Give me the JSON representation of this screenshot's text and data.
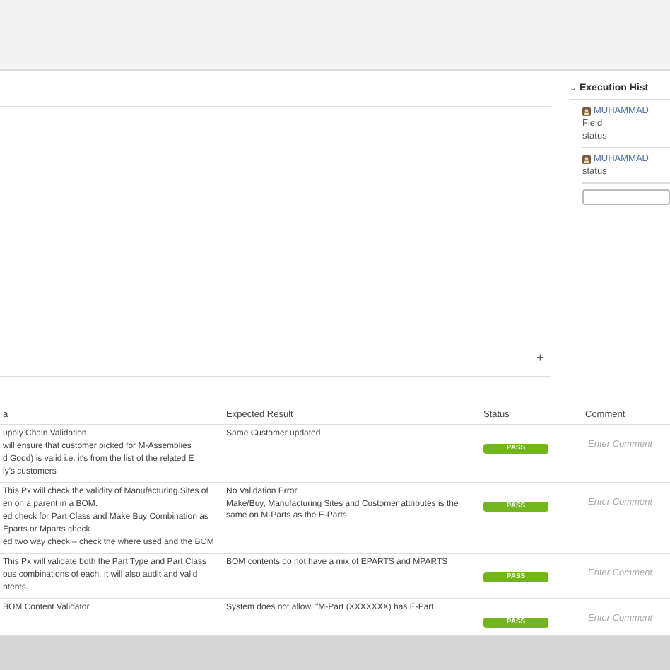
{
  "history": {
    "caret": "⌄",
    "title": "Execution Hist",
    "expanded": true,
    "entries": [
      {
        "user": "MUHAMMAD",
        "lines": [
          "Field",
          "status"
        ]
      },
      {
        "user": "MUHAMMAD",
        "lines": [
          "status"
        ]
      }
    ]
  },
  "add_symbol": "+",
  "table": {
    "columns": [
      "a",
      "Expected Result",
      "Status",
      "Comment"
    ],
    "rows": [
      {
        "description": [
          "upply Chain Validation",
          "will ensure that customer picked for M-Assemblies",
          "d Good) is valid i.e. it's from the list of the related E",
          "ly's customers"
        ],
        "expected": [
          "Same Customer updated"
        ],
        "status": "PASS",
        "comment_placeholder": "Enter Comment"
      },
      {
        "description": [
          "This Px will check the validity of Manufacturing Sites of",
          "en on a parent in a BOM.",
          "ed check for Part Class and Make Buy Combination as",
          "Eparts or Mparts check",
          "ed two way check – check the where used and the BOM"
        ],
        "expected": [
          "No Validation Error",
          "Make/Buy, Manufacturing Sites and Customer attributes is the same on M-Parts as the E-Parts"
        ],
        "status": "PASS",
        "comment_placeholder": "Enter Comment"
      },
      {
        "description": [
          "This Px will validate both the Part Type and Part Class",
          "ous combinations of each. It will also audit and valid",
          "ntents."
        ],
        "expected": [
          "BOM contents do not have a mix of EPARTS and MPARTS"
        ],
        "status": "PASS",
        "comment_placeholder": "Enter Comment"
      },
      {
        "description": [
          "BOM Content Validator"
        ],
        "expected": [
          "System does not allow. \"M-Part (XXXXXXX) has E-Part"
        ],
        "status": "PASS",
        "comment_placeholder": "Enter Comment"
      }
    ]
  }
}
